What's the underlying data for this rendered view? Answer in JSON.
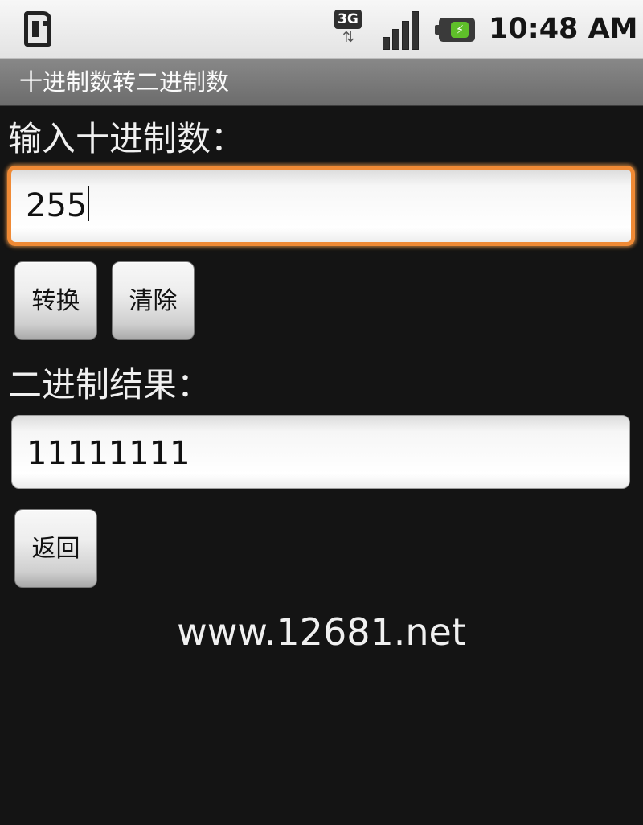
{
  "status_bar": {
    "network_label": "3G",
    "network_arrows": "⇅",
    "battery_glyph": "⚡",
    "time": "10:48 AM",
    "icons": [
      "sim-icon",
      "3g-icon",
      "signal-icon",
      "battery-charging-icon"
    ]
  },
  "title_bar": {
    "title": "十进制数转二进制数"
  },
  "form": {
    "input_label": "输入十进制数：",
    "input_value": "255",
    "convert_button": "转换",
    "clear_button": "清除",
    "result_label": "二进制结果：",
    "result_value": "11111111",
    "back_button": "返回"
  },
  "footer": {
    "watermark": "www.12681.net"
  },
  "colors": {
    "background": "#141414",
    "focus_border": "#f08a35",
    "title_bar": "#7a7a7a",
    "battery_accent": "#5fbf2a"
  }
}
